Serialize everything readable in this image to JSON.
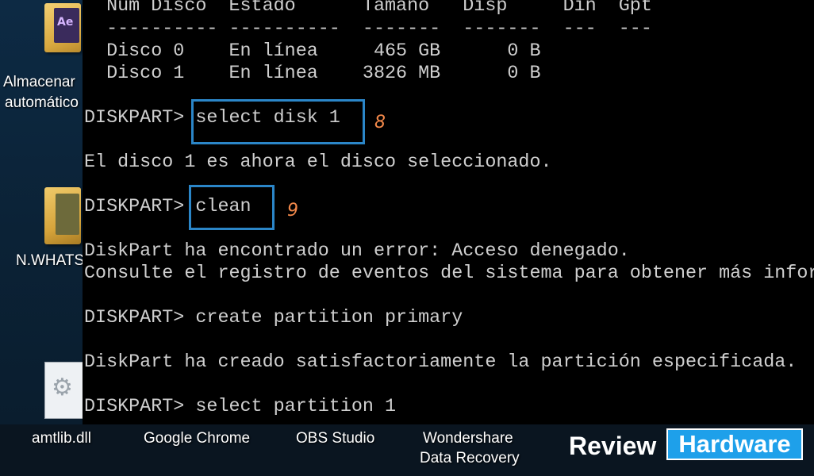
{
  "desktop": {
    "icons": [
      {
        "label_line1": "Almacenar",
        "label_line2": "automático",
        "badge": "Ae"
      },
      {
        "label": "N.WHATS"
      },
      {
        "label": "amtlib.dll"
      }
    ]
  },
  "console": {
    "lines": [
      "  Núm Disco  Estado      Tamaño   Disp     Din  Gpt",
      "  ---------- ----------  -------  -------  ---  ---",
      "  Disco 0    En línea     465 GB      0 B",
      "  Disco 1    En línea    3826 MB      0 B",
      "DISKPART> select disk 1",
      "El disco 1 es ahora el disco seleccionado.",
      "DISKPART> clean",
      "DiskPart ha encontrado un error: Acceso denegado.",
      "Consulte el registro de eventos del sistema para obtener más información.",
      "DISKPART> create partition primary",
      "DiskPart ha creado satisfactoriamente la partición especificada.",
      "DISKPART> select partition 1"
    ],
    "annotations": [
      "8",
      "9"
    ]
  },
  "taskbar": {
    "items": [
      "amtlib.dll",
      "Google Chrome",
      "OBS Studio",
      "Wondershare",
      "Data Recovery"
    ]
  },
  "watermark": {
    "word1": "Review",
    "word2": "Hardware"
  },
  "colors": {
    "highlight": "#2b86c8",
    "annotation": "#f2884a",
    "brand": "#1ea0ea"
  }
}
